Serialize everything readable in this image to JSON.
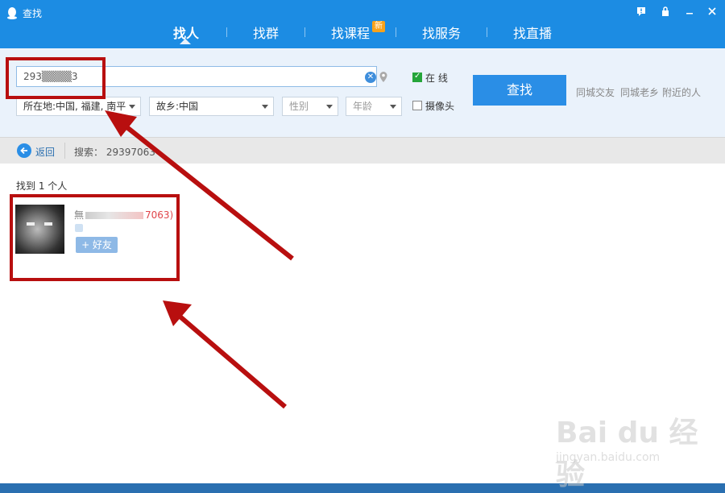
{
  "window": {
    "title": "查找",
    "controls": [
      "feedback-icon",
      "lock-icon",
      "minimize-icon",
      "close-icon"
    ]
  },
  "tabs": [
    {
      "label": "找人",
      "active": true
    },
    {
      "label": "找群",
      "active": false
    },
    {
      "label": "找课程",
      "active": false,
      "badge": "新"
    },
    {
      "label": "找服务",
      "active": false
    },
    {
      "label": "找直播",
      "active": false
    }
  ],
  "search": {
    "query": "293▒▒▒▒3",
    "online_label": "在  线",
    "online_checked": true,
    "camera_label": "摄像头",
    "camera_checked": false,
    "location": "所在地:中国, 福建, 南平",
    "hometown": "故乡:中国",
    "gender": "性别",
    "age": "年龄",
    "find_button": "查找",
    "quick_links": [
      "同城交友",
      "同城老乡",
      "附近的人"
    ]
  },
  "toolbar": {
    "back_label": "返回",
    "search_info": "搜索： 29397063"
  },
  "results": {
    "count_text": "找到 1 个人",
    "items": [
      {
        "name_prefix": "無",
        "name_suffix": "7063)",
        "add_label": "+ 好友"
      }
    ]
  },
  "watermark": {
    "logo": "Bai du 经验",
    "url": "jingyan.baidu.com"
  },
  "colors": {
    "titlebar": "#1c8ce3",
    "accent": "#2a8ee6",
    "annotation": "#b80f0f",
    "name_red": "#e0454a"
  }
}
